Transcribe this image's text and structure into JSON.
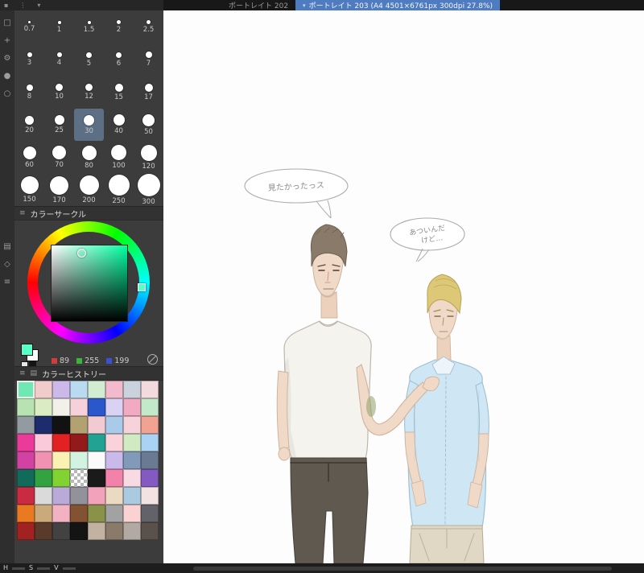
{
  "colors": {
    "accent_tab": "#4f7cc0",
    "panel_bg": "#3c3c3c",
    "selected_brush_bg": "#5c6f85",
    "foreground": "#59ffc7",
    "background": "#ffffff"
  },
  "palette_toolbar": {
    "icons": [
      {
        "name": "panel-grid-icon",
        "glyph": "▪"
      },
      {
        "name": "panel-menu-icon",
        "glyph": "⋮"
      },
      {
        "name": "panel-collapse-icon",
        "glyph": "▾"
      }
    ]
  },
  "tabbar": {
    "tabs": [
      {
        "label": "ポートレイト 202",
        "active": false
      },
      {
        "label": "ポートレイト 203 (A4 4501×6761px 300dpi 27.8%)",
        "active": true
      }
    ],
    "caret": "▾"
  },
  "toolstrip": {
    "icons": [
      {
        "name": "selection-tool-icon",
        "glyph": "□"
      },
      {
        "name": "move-tool-icon",
        "glyph": "+"
      },
      {
        "name": "settings-gear-icon",
        "glyph": "⚙"
      },
      {
        "name": "brush-tool-icon",
        "glyph": "●"
      },
      {
        "name": "eraser-tool-icon",
        "glyph": "○"
      },
      {
        "name": "layer-panel-icon",
        "glyph": "▤"
      },
      {
        "name": "gradient-tool-icon",
        "glyph": "◇"
      },
      {
        "name": "menu-lines-icon",
        "glyph": "≡"
      }
    ]
  },
  "brush_panel": {
    "sizes": [
      "0.7",
      "1",
      "1.5",
      "2",
      "2.5",
      "3",
      "4",
      "5",
      "6",
      "7",
      "8",
      "10",
      "12",
      "15",
      "17",
      "20",
      "25",
      "30",
      "40",
      "50",
      "60",
      "70",
      "80",
      "100",
      "120",
      "150",
      "170",
      "200",
      "250",
      "300"
    ],
    "selected": "30"
  },
  "color_wheel_panel": {
    "title": "カラーサークル",
    "menu_icon": "≡",
    "rgb": {
      "r": "89",
      "g": "255",
      "b": "199"
    }
  },
  "color_history_panel": {
    "title": "カラーヒストリー",
    "menu_icon": "≡",
    "film_icon": "▤",
    "selected_index": 0,
    "colors": [
      "#6fe8b4",
      "#f2cbcb",
      "#cdb9e9",
      "#badaf2",
      "#d2ecd2",
      "#f2bacc",
      "#cad2de",
      "#f2dade",
      "#b9e2b2",
      "#daecc2",
      "#f1f1ea",
      "#f6d1da",
      "#2a58cc",
      "#dad2f2",
      "#f2aac2",
      "#c2eaca",
      "#929aa2",
      "#1c2c6c",
      "#121212",
      "#b2a272",
      "#f2cad2",
      "#aacaea",
      "#f6d2da",
      "#f2a292",
      "#ea3a9a",
      "#facada",
      "#e22222",
      "#921a1a",
      "#22a292",
      "#fad2da",
      "#d2eac2",
      "#aad2f2",
      "#d242a2",
      "#f292b2",
      "#faf2b2",
      "#d2f2e2",
      "#fafafa",
      "#cabaea",
      "#829aba",
      "#6a7a92",
      "#126a5a",
      "#32a242",
      "#82d232",
      "checker",
      "#1a1a1a",
      "#f282aa",
      "#fadae2",
      "#825ac2",
      "#ca2a42",
      "#dadada",
      "#baaada",
      "#92929a",
      "#f2a2ba",
      "#eadac2",
      "#aacae2",
      "#f2e2e2",
      "#ea7a22",
      "#caaa7a",
      "#f2b2c2",
      "#825232",
      "#8a924a",
      "#a2a2a2",
      "#fad2d2",
      "#62626a",
      "#a22222",
      "#5a3a2a",
      "#424242",
      "#141414",
      "#c2b2a2",
      "#8a7a6a",
      "#b2aaa2",
      "#5a524a"
    ]
  },
  "statusbar": {
    "labels": [
      "H",
      "S",
      "V"
    ]
  },
  "canvas": {
    "bubble1_text": "見たかったっス",
    "bubble2_line1": "あついんだ",
    "bubble2_line2": "けど…"
  }
}
